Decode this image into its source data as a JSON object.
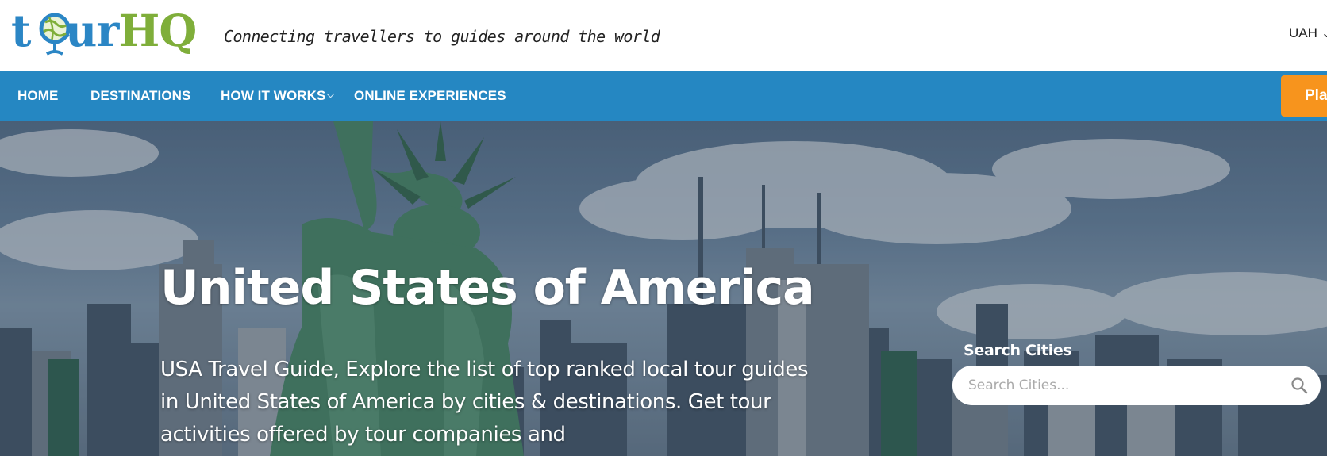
{
  "header": {
    "logo": {
      "text_part1": "t",
      "text_part2": "ur",
      "text_part3": "HQ"
    },
    "tagline": "Connecting travellers to guides around the world",
    "currency": "UAH ⌄"
  },
  "nav": {
    "items": [
      {
        "label": "HOME"
      },
      {
        "label": "DESTINATIONS"
      },
      {
        "label": "HOW IT WORKS"
      },
      {
        "label": "ONLINE EXPERIENCES"
      }
    ],
    "cta_label": "Pla"
  },
  "hero": {
    "title": "United States of America",
    "description": "USA Travel Guide, Explore the list of top ranked local tour guides in United States of America by cities & destinations. Get tour activities offered by tour companies and",
    "search": {
      "label": "Search Cities",
      "placeholder": "Search Cities..."
    }
  },
  "colors": {
    "brand_blue": "#2587c2",
    "brand_green": "#7fae3a",
    "cta_orange": "#f7941d"
  },
  "icons": {
    "search": "search-icon",
    "dropdown": "chevron-down-icon",
    "logo_globe": "globe-icon"
  }
}
